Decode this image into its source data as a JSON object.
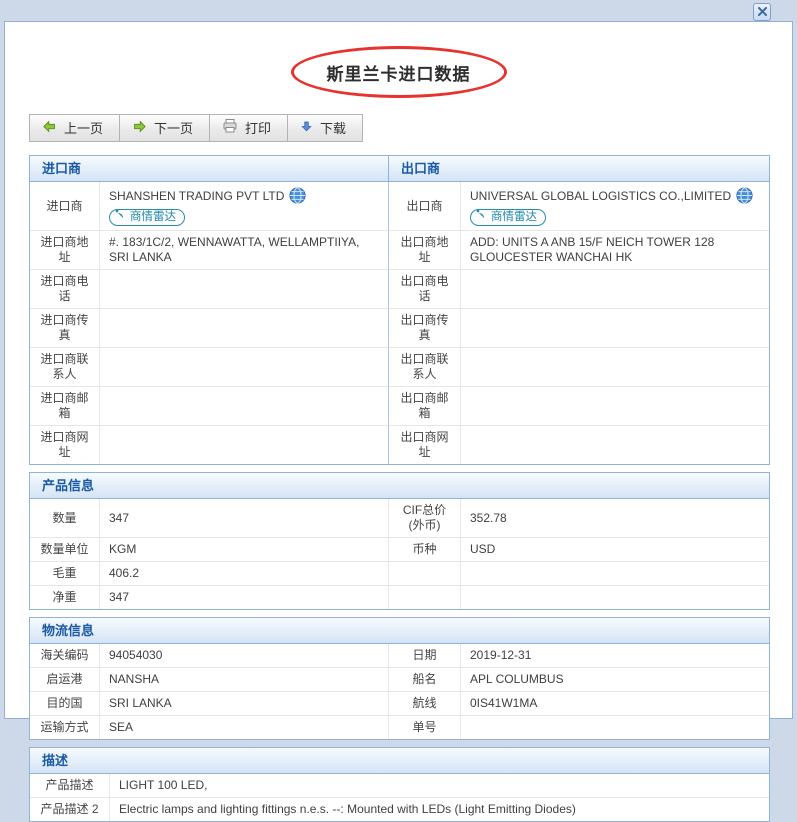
{
  "colors": {
    "frame": "#cdd8e9",
    "panel_border": "#94aed6",
    "section_border": "#8fb3dc",
    "section_header_text": "#1a5aa5",
    "title_ellipse_red": "#e8322e",
    "badge_teal": "#1e87a8"
  },
  "dialog": {
    "title": "斯里兰卡进口数据"
  },
  "toolbar": {
    "prev_label": "上一页",
    "next_label": "下一页",
    "print_label": "打印",
    "download_label": "下载"
  },
  "radar_badge_label": "商情雷达",
  "importer": {
    "header": "进口商",
    "company_label": "进口商",
    "company": "SHANSHEN TRADING PVT LTD",
    "rows": [
      {
        "label": "进口商地址",
        "value": "#. 183/1C/2, WENNAWATTA, WELLAMPTIIYA, SRI LANKA"
      },
      {
        "label": "进口商电话",
        "value": ""
      },
      {
        "label": "进口商传真",
        "value": ""
      },
      {
        "label": "进口商联系人",
        "value": ""
      },
      {
        "label": "进口商邮箱",
        "value": ""
      },
      {
        "label": "进口商网址",
        "value": ""
      }
    ]
  },
  "exporter": {
    "header": "出口商",
    "company_label": "出口商",
    "company": "UNIVERSAL GLOBAL LOGISTICS CO.,LIMITED",
    "rows": [
      {
        "label": "出口商地址",
        "value": "ADD: UNITS A ANB 15/F NEICH TOWER 128 GLOUCESTER WANCHAI HK"
      },
      {
        "label": "出口商电话",
        "value": ""
      },
      {
        "label": "出口商传真",
        "value": ""
      },
      {
        "label": "出口商联系人",
        "value": ""
      },
      {
        "label": "出口商邮箱",
        "value": ""
      },
      {
        "label": "出口商网址",
        "value": ""
      }
    ]
  },
  "product": {
    "header": "产品信息",
    "rows": [
      {
        "l1": "数量",
        "v1": "347",
        "l2": "CIF总价(外币)",
        "v2": "352.78"
      },
      {
        "l1": "数量单位",
        "v1": "KGM",
        "l2": "币种",
        "v2": "USD"
      },
      {
        "l1": "毛重",
        "v1": "406.2",
        "l2": "",
        "v2": ""
      },
      {
        "l1": "净重",
        "v1": "347",
        "l2": "",
        "v2": ""
      }
    ]
  },
  "logistics": {
    "header": "物流信息",
    "rows": [
      {
        "l1": "海关编码",
        "v1": "94054030",
        "l2": "日期",
        "v2": "2019-12-31"
      },
      {
        "l1": "启运港",
        "v1": "NANSHA",
        "l2": "船名",
        "v2": "APL COLUMBUS"
      },
      {
        "l1": "目的国",
        "v1": "SRI LANKA",
        "l2": "航线",
        "v2": "0IS41W1MA"
      },
      {
        "l1": "运输方式",
        "v1": "SEA",
        "l2": "单号",
        "v2": ""
      }
    ]
  },
  "description": {
    "header": "描述",
    "rows": [
      {
        "label": "产品描述",
        "value": "LIGHT 100 LED,"
      },
      {
        "label": "产品描述 2",
        "value": "Electric lamps and lighting fittings n.e.s. --: Mounted with LEDs (Light Emitting Diodes)"
      }
    ]
  }
}
